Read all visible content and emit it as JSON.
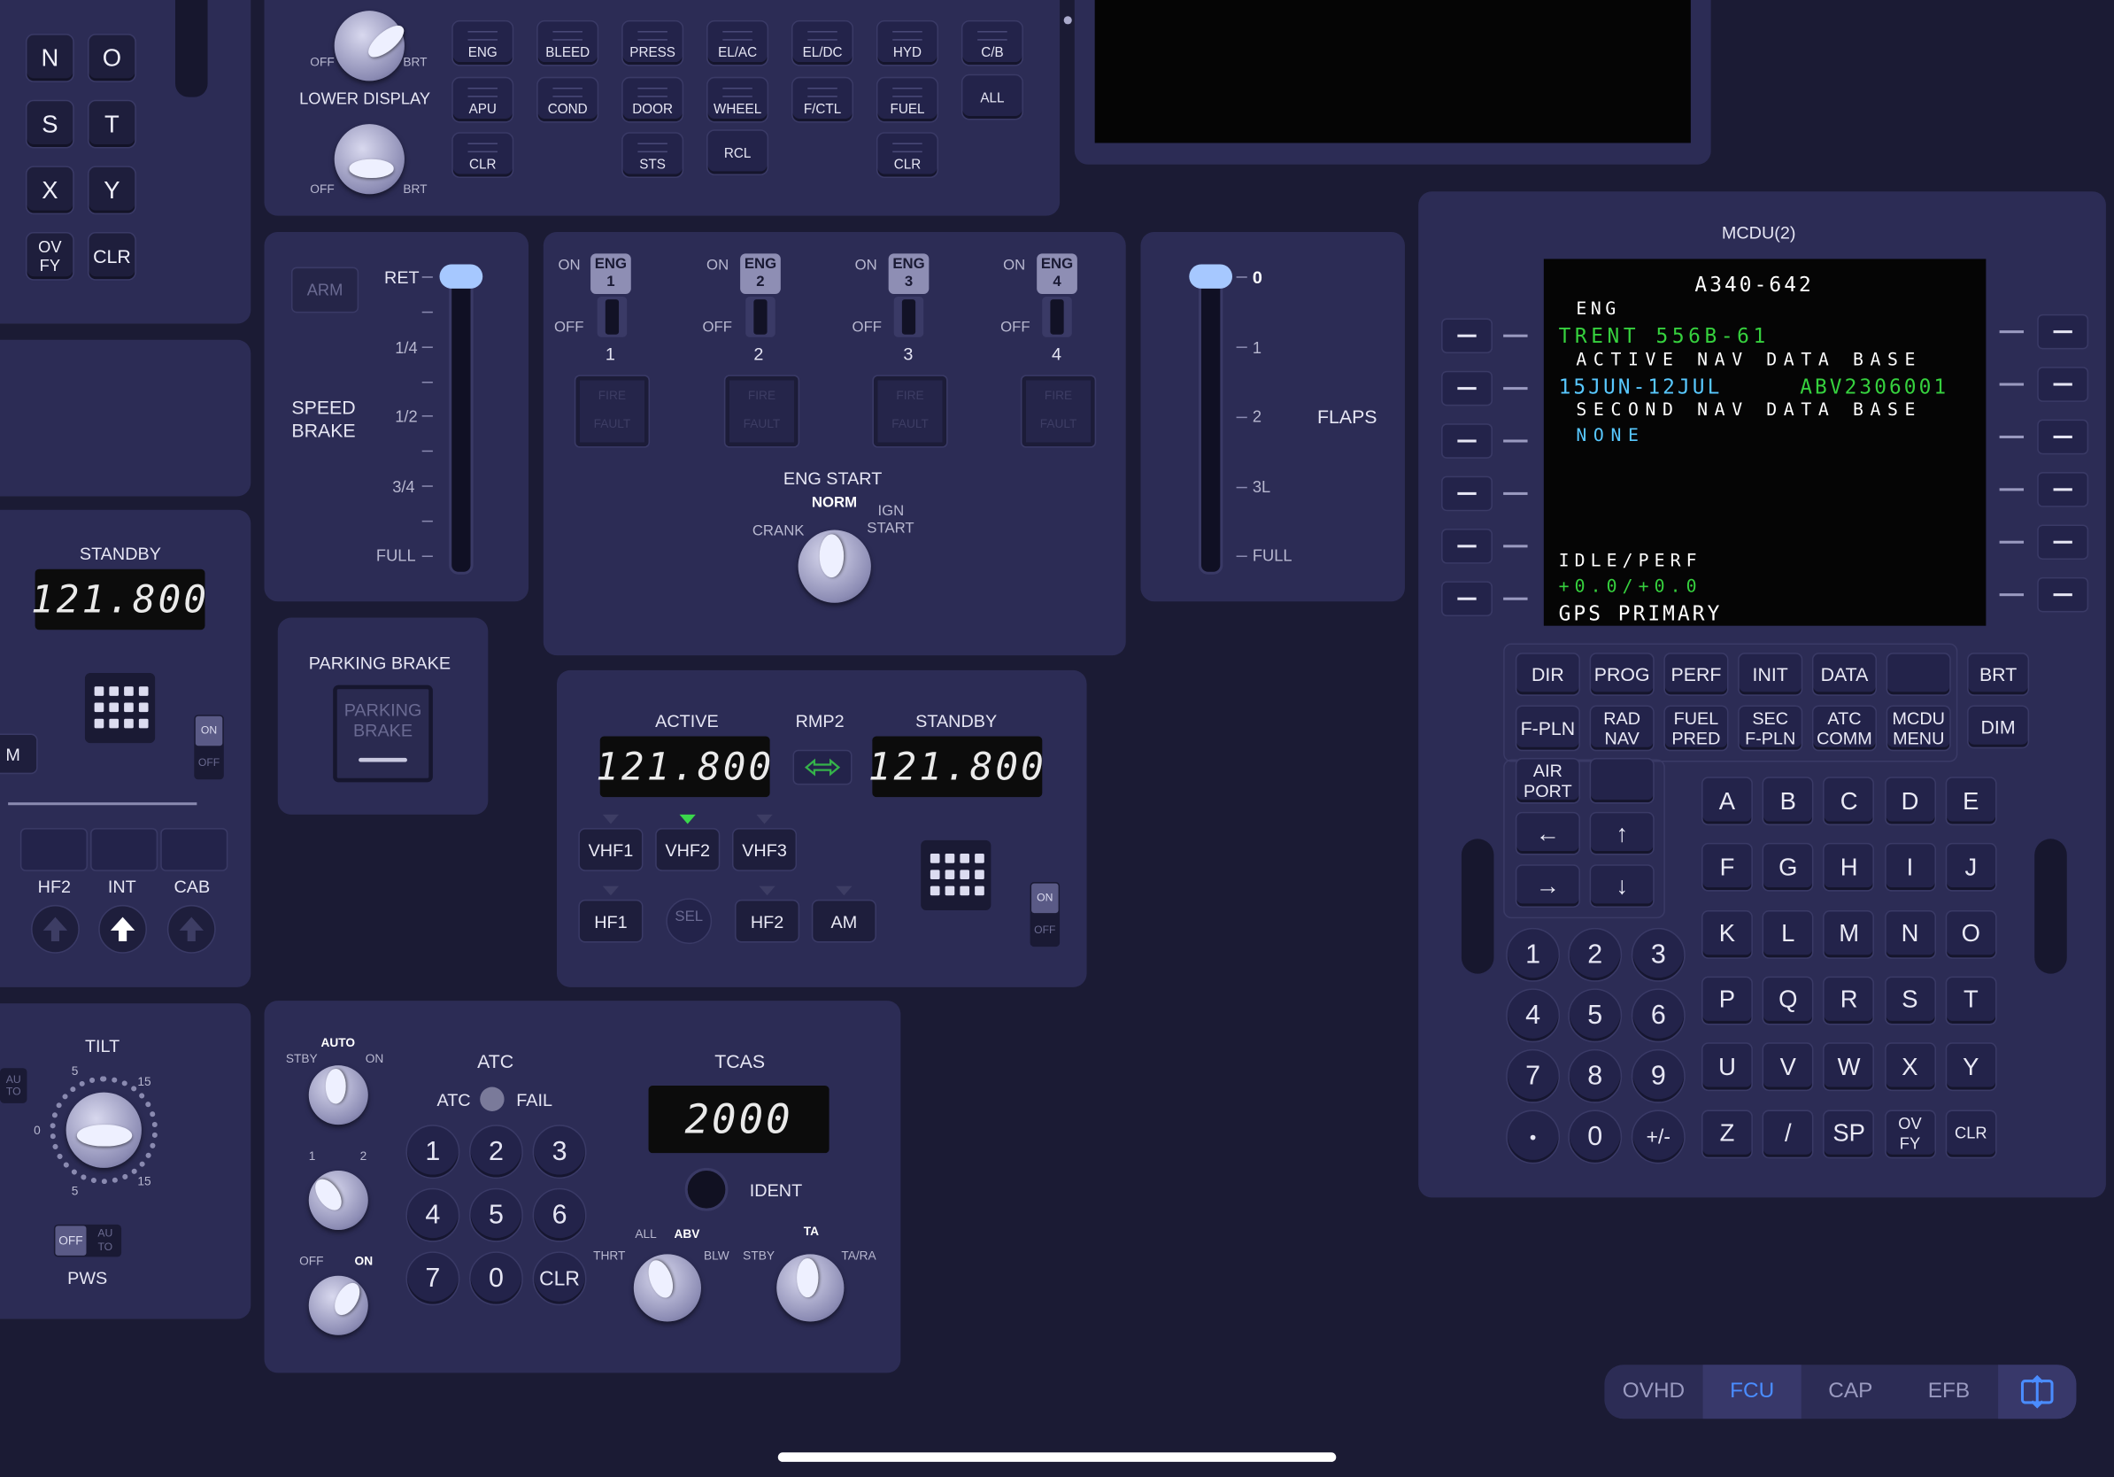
{
  "left_keypad": {
    "rows": [
      [
        "N",
        "O"
      ],
      [
        "S",
        "T"
      ],
      [
        "X",
        "Y"
      ],
      [
        "OV\nFY",
        "CLR"
      ]
    ]
  },
  "ecam": {
    "upper_knob": {
      "off": "OFF",
      "brt": "BRT"
    },
    "lower_display": {
      "title": "LOWER DISPLAY",
      "off": "OFF",
      "brt": "BRT"
    },
    "row1": [
      "ENG",
      "BLEED",
      "PRESS",
      "EL/AC",
      "EL/DC",
      "HYD",
      "C/B"
    ],
    "row2": [
      "APU",
      "COND",
      "DOOR",
      "WHEEL",
      "F/CTL",
      "FUEL",
      "ALL"
    ],
    "row3": [
      "CLR",
      "STS",
      "RCL",
      "CLR"
    ]
  },
  "speed_brake": {
    "title": "SPEED\nBRAKE",
    "arm": "ARM",
    "ret": "RET",
    "marks": [
      "1/4",
      "1/2",
      "3/4",
      "FULL"
    ]
  },
  "engines": {
    "on": "ON",
    "off": "OFF",
    "masters": [
      {
        "tag": "ENG\n1",
        "num": "1"
      },
      {
        "tag": "ENG\n2",
        "num": "2"
      },
      {
        "tag": "ENG\n3",
        "num": "3"
      },
      {
        "tag": "ENG\n4",
        "num": "4"
      }
    ],
    "fire": "FIRE",
    "fault": "FAULT",
    "eng_start": {
      "title": "ENG START",
      "crank": "CRANK",
      "norm": "NORM",
      "ign": "IGN",
      "start": "START"
    }
  },
  "flaps": {
    "title": "FLAPS",
    "marks": [
      "0",
      "1",
      "2",
      "3L",
      "FULL"
    ]
  },
  "standby_left": {
    "title": "STANDBY",
    "freq": "121.800",
    "side_m": "M",
    "on": "ON",
    "off": "OFF"
  },
  "parking_brake": {
    "title": "PARKING BRAKE",
    "button": "PARKING\nBRAKE"
  },
  "rmp2": {
    "active_label": "ACTIVE",
    "title": "RMP2",
    "standby_label": "STANDBY",
    "active": "121.800",
    "standby": "121.800",
    "vhf": [
      "VHF1",
      "VHF2",
      "VHF3"
    ],
    "hf": [
      "HF1",
      "SEL",
      "HF2",
      "AM"
    ],
    "on": "ON",
    "off": "OFF"
  },
  "audio": {
    "labels": [
      "HF2",
      "INT",
      "CAB"
    ]
  },
  "tilt": {
    "title": "TILT",
    "s": "5",
    "n15": "15",
    "zero": "0",
    "pws": "PWS",
    "pws_off": "OFF",
    "pws_auto": "AU\nTO",
    "side": "AU\nTO"
  },
  "atc": {
    "mode_knob": {
      "stby": "STBY",
      "auto": "AUTO",
      "on": "ON"
    },
    "sys_knob": {
      "one": "1",
      "two": "2"
    },
    "alt_knob": {
      "off": "OFF",
      "on": "ON"
    },
    "title": "ATC",
    "atc": "ATC",
    "fail": "FAIL",
    "keys": [
      "1",
      "2",
      "3",
      "4",
      "5",
      "6",
      "7",
      "0",
      "CLR"
    ]
  },
  "tcas": {
    "title": "TCAS",
    "code": "2000",
    "ident": "IDENT",
    "range": {
      "all": "ALL",
      "abv": "ABV",
      "thrt": "THRT",
      "blw": "BLW"
    },
    "mode": {
      "stby": "STBY",
      "ta": "TA",
      "tara": "TA/RA"
    }
  },
  "mcdu": {
    "title": "MCDU(2)",
    "screen": [
      {
        "text": "A340-642",
        "color": "#ffffff"
      },
      {
        "text": "ENG",
        "color": "#ffffff"
      },
      {
        "text": "TRENT 556B-61",
        "color": "#36d13e"
      },
      {
        "text": "ACTIVE NAV DATA BASE",
        "color": "#ffffff"
      },
      {
        "text": "15JUN-12JUL",
        "color": "#58c8ff"
      },
      {
        "text": "ABV2306001",
        "color": "#36d13e"
      },
      {
        "text": "SECOND NAV DATA BASE",
        "color": "#ffffff"
      },
      {
        "text": "NONE",
        "color": "#58c8ff"
      },
      {
        "text": "IDLE/PERF",
        "color": "#ffffff"
      },
      {
        "text": "+0.0/+0.0",
        "color": "#36d13e"
      },
      {
        "text": "GPS PRIMARY",
        "color": "#ffffff"
      }
    ],
    "func_row1": [
      "DIR",
      "PROG",
      "PERF",
      "INIT",
      "DATA",
      ""
    ],
    "func_row2": [
      "F-PLN",
      "RAD\nNAV",
      "FUEL\nPRED",
      "SEC\nF-PLN",
      "ATC\nCOMM",
      "MCDU\nMENU"
    ],
    "brt": "BRT",
    "dim": "DIM",
    "airport": "AIR\nPORT",
    "arrows": [
      "←",
      "↑",
      "→",
      "↓"
    ],
    "numbers": [
      "1",
      "2",
      "3",
      "4",
      "5",
      "6",
      "7",
      "8",
      "9",
      "•",
      "0",
      "+/-"
    ],
    "letters": [
      "A",
      "B",
      "C",
      "D",
      "E",
      "F",
      "G",
      "H",
      "I",
      "J",
      "K",
      "L",
      "M",
      "N",
      "O",
      "P",
      "Q",
      "R",
      "S",
      "T",
      "U",
      "V",
      "W",
      "X",
      "Y",
      "Z",
      "/",
      "SP",
      "OV\nFY",
      "CLR"
    ]
  },
  "tabs": {
    "items": [
      "OVHD",
      "FCU",
      "CAP",
      "EFB"
    ],
    "active": "FCU",
    "active_color": "#4a8cff"
  }
}
